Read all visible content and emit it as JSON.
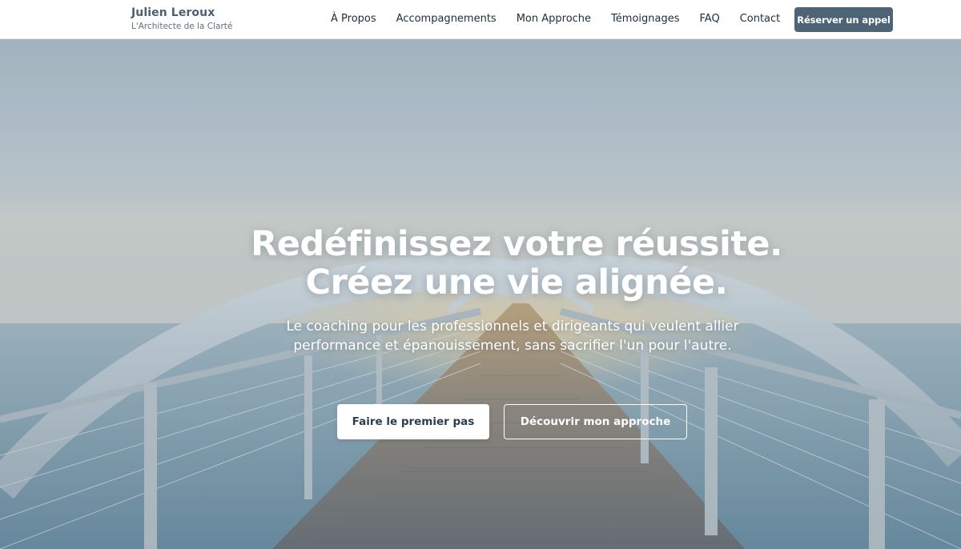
{
  "header": {
    "brand_name": "Julien Leroux",
    "brand_tagline": "L'Architecte de la Clarté",
    "nav": [
      {
        "label": "À Propos"
      },
      {
        "label": "Accompagnements"
      },
      {
        "label": "Mon Approche"
      },
      {
        "label": "Témoignages"
      },
      {
        "label": "FAQ"
      },
      {
        "label": "Contact"
      }
    ],
    "cta_label": "Réserver un appel"
  },
  "hero": {
    "title_line1": "Redéfinissez votre réussite.",
    "title_line2": "Créez une vie alignée.",
    "subtitle": "Le coaching pour les professionnels et dirigeants qui veulent allier performance et épanouissement, sans sacrifier l'un pour l'autre.",
    "primary_button": "Faire le premier pas",
    "secondary_button": "Découvrir mon approche"
  },
  "colors": {
    "brand": "#4b6070",
    "cta_bg": "#4d6476",
    "nav_text": "#1f2d38"
  }
}
